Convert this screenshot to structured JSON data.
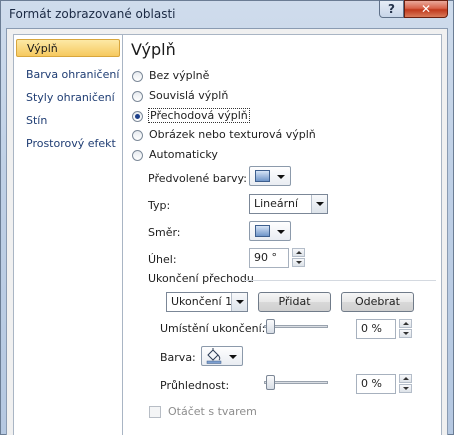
{
  "window": {
    "title": "Formát zobrazované oblasti",
    "help": "?",
    "close": "✕"
  },
  "nav": {
    "items": [
      {
        "label": "Výplň",
        "selected": true
      },
      {
        "label": "Barva ohraničení"
      },
      {
        "label": "Styly ohraničení"
      },
      {
        "label": "Stín"
      },
      {
        "label": "Prostorový efekt"
      }
    ]
  },
  "fill": {
    "heading": "Výplň",
    "options": [
      {
        "label": "Bez výplně",
        "checked": false
      },
      {
        "label": "Souvislá výplň",
        "checked": false
      },
      {
        "label": "Přechodová výplň",
        "checked": true
      },
      {
        "label": "Obrázek nebo texturová výplň",
        "checked": false
      },
      {
        "label": "Automaticky",
        "checked": false
      }
    ],
    "preset_colors_label": "Předvolené barvy:",
    "type_label": "Typ:",
    "type_value": "Lineární",
    "direction_label": "Směr:",
    "angle_label": "Úhel:",
    "angle_value": "90 °",
    "stops_heading": "Ukončení přechodu",
    "stop_value": "Ukončení 1",
    "add_button": "Přidat",
    "remove_button": "Odebrat",
    "stop_position_label": "Umístění ukončení:",
    "stop_position_value": "0 %",
    "color_label": "Barva:",
    "transparency_label": "Průhlednost:",
    "transparency_value": "0 %",
    "rotate_label": "Otáčet s tvarem",
    "stop_position_slider": 0,
    "transparency_slider": 0
  },
  "colors": {
    "swatch": "#8fb0dc",
    "nav_selected": "#f6c95f"
  },
  "icons": {
    "help": "question-icon",
    "close": "close-icon",
    "bucket": "paint-bucket-icon"
  }
}
